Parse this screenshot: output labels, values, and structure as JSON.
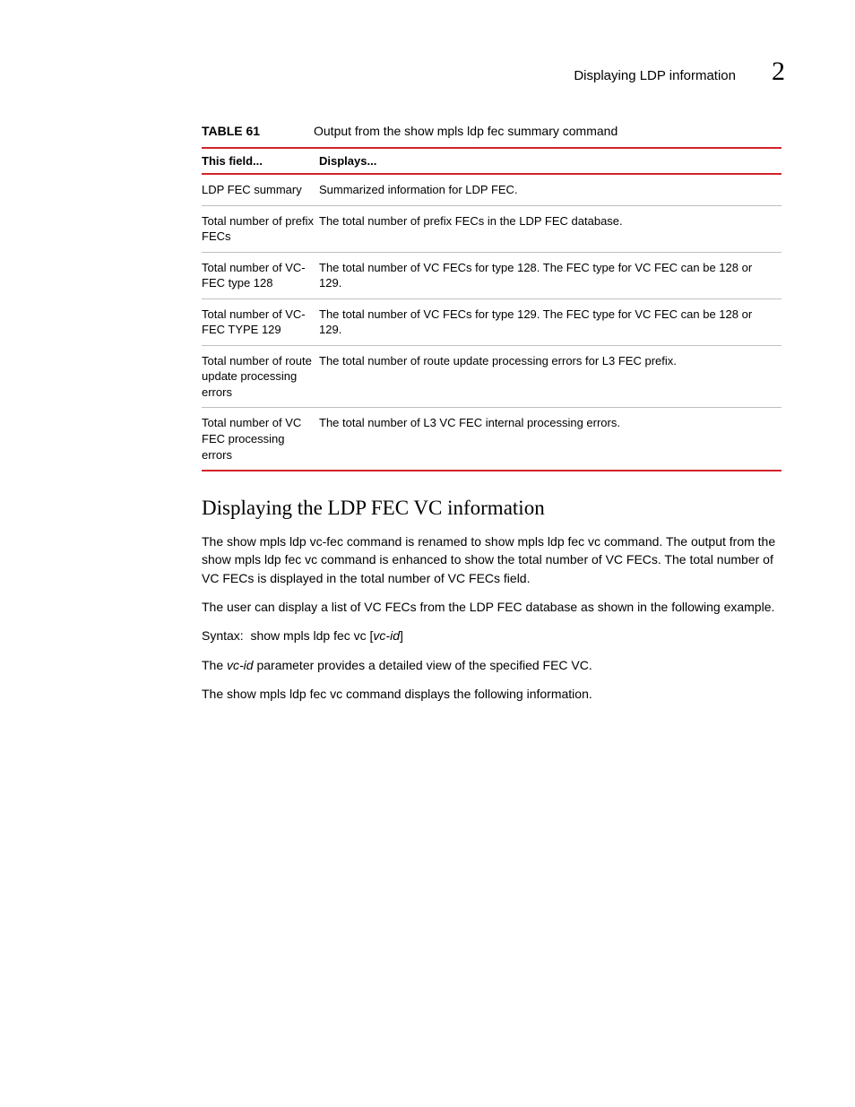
{
  "header": {
    "title": "Displaying LDP information",
    "chapter_number": "2"
  },
  "table": {
    "label": "TABLE 61",
    "caption": "Output from the show mpls ldp fec summary command",
    "head_field": "This field...",
    "head_displays": "Displays...",
    "rows": [
      {
        "field": "LDP FEC summary",
        "displays": "Summarized information for LDP FEC."
      },
      {
        "field": "Total number of prefix FECs",
        "displays": "The total number of prefix FECs in the LDP FEC database."
      },
      {
        "field": "Total number of VC-FEC type 128",
        "displays": "The total number of VC FECs for type 128. The FEC type for VC FEC can be 128 or 129."
      },
      {
        "field": "Total number of VC-FEC TYPE 129",
        "displays": "The total number of VC FECs for type 129. The FEC type for VC FEC can be 128 or 129."
      },
      {
        "field": "Total number of route update processing errors",
        "displays": "The total number of route update processing errors for L3 FEC prefix."
      },
      {
        "field": "Total number of VC FEC processing errors",
        "displays": "The total number of L3 VC FEC internal processing errors."
      }
    ]
  },
  "section": {
    "heading": "Displaying the LDP FEC VC information",
    "para1": "The show mpls ldp vc-fec command is renamed to show mpls ldp fec vc command. The output from the show mpls ldp fec vc command is enhanced to show the total number of VC FECs. The total number of VC FECs is displayed in the total number of VC FECs field.",
    "para2": "The user can display a list of VC FECs from the LDP FEC database as shown in the following example.",
    "syntax_label": "Syntax:",
    "syntax_cmd": "show mpls ldp fec vc [",
    "syntax_param": "vc-id",
    "syntax_close": "]",
    "para3a": "The ",
    "para3b": "vc-id",
    "para3c": " parameter provides a detailed view of the specified FEC VC.",
    "para4": "The show mpls ldp fec vc command displays the following information."
  }
}
